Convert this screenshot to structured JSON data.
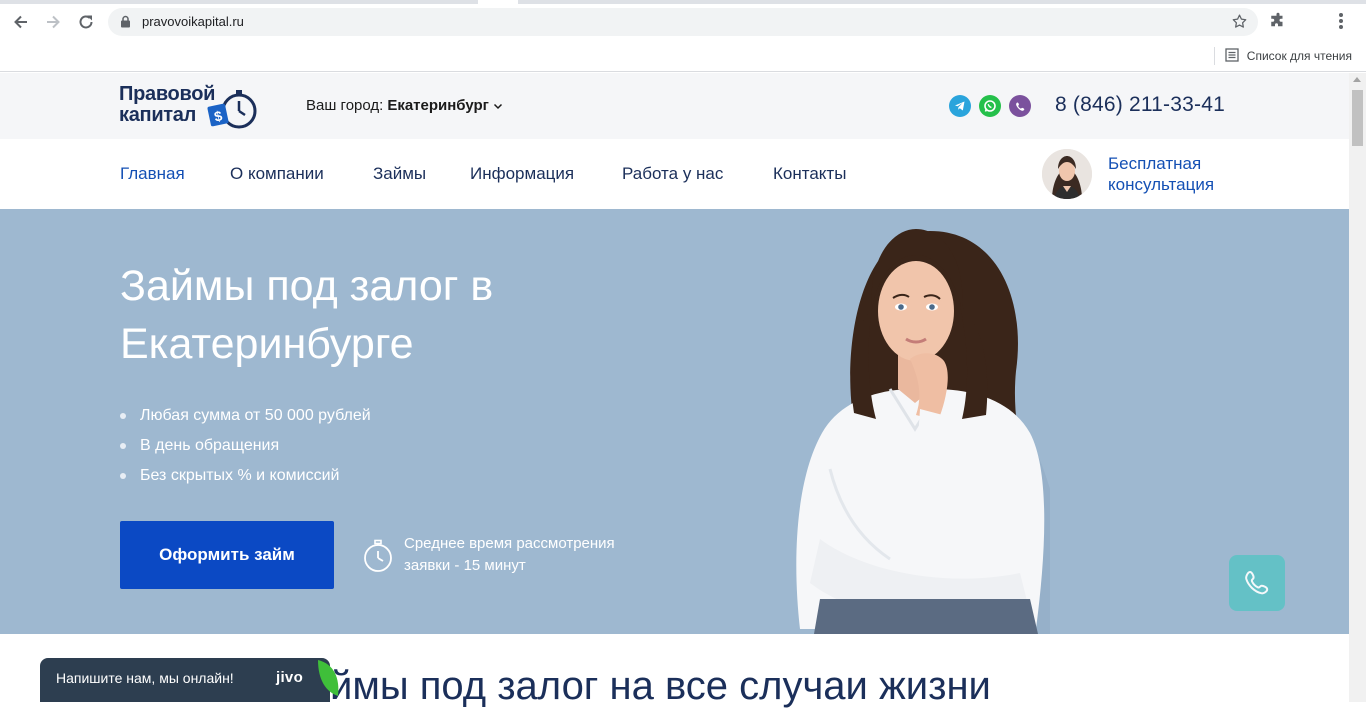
{
  "browser": {
    "url": "pravovoikapital.ru",
    "reading_list_label": "Список для чтения",
    "icons": [
      "back-icon",
      "forward-icon",
      "reload-icon",
      "lock-icon",
      "star-icon",
      "extensions-icon",
      "menu-icon",
      "reading-list-icon"
    ]
  },
  "header": {
    "logo_line1": "Правовой",
    "logo_line2": "капитал",
    "city_label": "Ваш город:",
    "city_value": "Екатеринбург",
    "messengers": [
      "telegram-icon",
      "whatsapp-icon",
      "viber-icon"
    ],
    "phone": "8 (846) 211-33-41"
  },
  "nav": {
    "items": [
      {
        "label": "Главная",
        "active": true
      },
      {
        "label": "О компании"
      },
      {
        "label": "Займы"
      },
      {
        "label": "Информация"
      },
      {
        "label": "Работа у нас"
      },
      {
        "label": "Контакты"
      }
    ],
    "consult_line1": "Бесплатная",
    "consult_line2": "консультация"
  },
  "hero": {
    "title_line1": "Займы под залог в",
    "title_line2": "Екатеринбурге",
    "bullets": [
      "Любая сумма от 50 000 рублей",
      "В день обращения",
      "Без скрытых % и комиссий"
    ],
    "cta_label": "Оформить займ",
    "review_line1": "Среднее время рассмотрения",
    "review_line2": "заявки - 15 минут"
  },
  "section": {
    "title_partial": "ймы под залог на все случаи жизни"
  },
  "chat": {
    "text": "Напишите нам, мы онлайн!",
    "brand": "jivo"
  },
  "colors": {
    "brand_dark": "#1b2f5a",
    "brand_blue": "#1450b4",
    "cta": "#0b49c4",
    "hero_bg": "#9eb8d0",
    "call_float": "#5ec3c6"
  }
}
